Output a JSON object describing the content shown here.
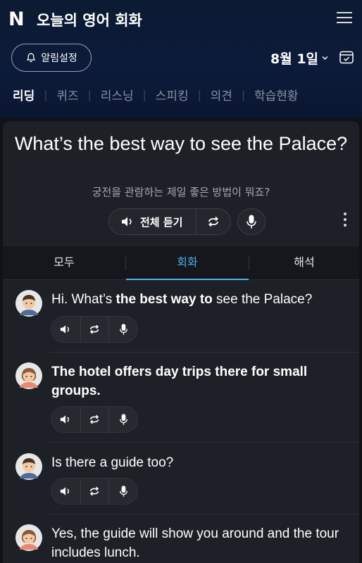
{
  "header": {
    "logo": "N",
    "title": "오늘의 영어 회화",
    "alarm_label": "알림설정",
    "date_label": "8월 1일"
  },
  "nav_tabs": [
    "리딩",
    "퀴즈",
    "리스닝",
    "스피킹",
    "의견",
    "학습현황"
  ],
  "nav_active_index": 0,
  "question": {
    "english": "What’s the best way to see the Palace?",
    "korean": "궁전을 관람하는 제일 좋은 방법이 뭐죠?",
    "play_all_label": "전체 듣기"
  },
  "mode_tabs": [
    "모두",
    "회화",
    "해석"
  ],
  "mode_active_index": 1,
  "dialogue": [
    {
      "speaker": "male",
      "pre": "Hi. What’s ",
      "bold": "the best way to",
      "post": " see the Palace?"
    },
    {
      "speaker": "female",
      "pre": "",
      "bold": "The hotel offers day trips there for small groups.",
      "post": ""
    },
    {
      "speaker": "male",
      "pre": "Is there a guide too?",
      "bold": "",
      "post": ""
    },
    {
      "speaker": "female",
      "pre": "Yes, the guide will show you around and the tour includes lunch.",
      "bold": "",
      "post": ""
    }
  ],
  "icons": {
    "menu": "menu-icon",
    "bell": "bell-icon",
    "calendar": "calendar-check-icon",
    "speaker": "speaker-icon",
    "repeat": "repeat-icon",
    "mic": "microphone-icon",
    "more": "more-vertical-icon"
  },
  "colors": {
    "header_bg": "#0c1b3a",
    "accent": "#4fb1e8",
    "card_bg": "#1d2026"
  }
}
